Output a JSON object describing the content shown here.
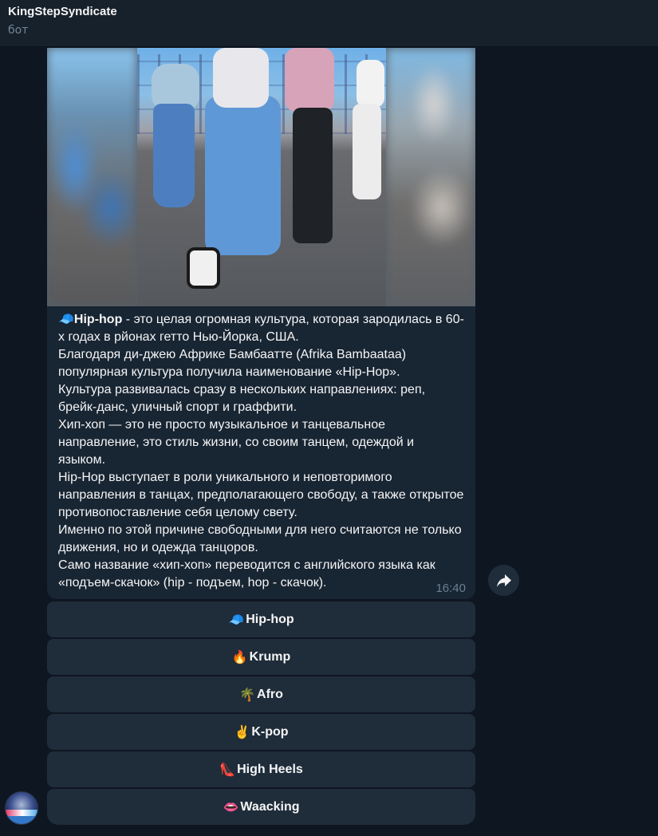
{
  "header": {
    "title": "KingStepSyndicate",
    "subtitle": "бот"
  },
  "message": {
    "lead_emoji": "🧢",
    "lead_bold": "Hip-hop",
    "lead_rest": " - это целая огромная культура, которая зародилась в 60-х годах в рйонах гетто Нью-Йорка, США.",
    "paragraphs": [
      "Благодаря ди-джею Африке Бамбаатте (Afrika Bambaataa) популярная культура получила наименование «Hip-Hop».",
      "Культура развивалась сразу в нескольких направлениях: реп, брейк-данс, уличный спорт и граффити.",
      "Хип-хоп — это не просто музыкальное и танцевальное направление, это стиль жизни, со своим танцем, одеждой и языком.",
      "Hip-Hop выступает в роли уникального и неповторимого направления в танцах, предполагающего свободу, а также открытое противопоставление себя целому свету.",
      "Именно по этой причине свободными для него считаются не только движения, но и одежда танцоров.",
      "Само название «хип-хоп» переводится с английского языка как «подъем-скачок» (hip - подъем, hop - скачок)."
    ],
    "time": "16:40",
    "media_icon": "dance-video-photo"
  },
  "keyboard": {
    "buttons": [
      {
        "emoji": "🧢",
        "label": "Hip-hop"
      },
      {
        "emoji": "🔥",
        "label": "Krump"
      },
      {
        "emoji": "🌴",
        "label": "Afro"
      },
      {
        "emoji": "✌",
        "label": "K-pop"
      },
      {
        "emoji": "👠",
        "label": "High Heels"
      },
      {
        "emoji": "👄",
        "label": "Waacking"
      }
    ]
  },
  "icons": {
    "share": "share-arrow-icon"
  },
  "colors": {
    "background": "#0e1621",
    "header": "#17212b",
    "bubble": "#182533",
    "button": "#1f2c3a",
    "time": "#6d7f8f",
    "subtitle": "#708499"
  }
}
